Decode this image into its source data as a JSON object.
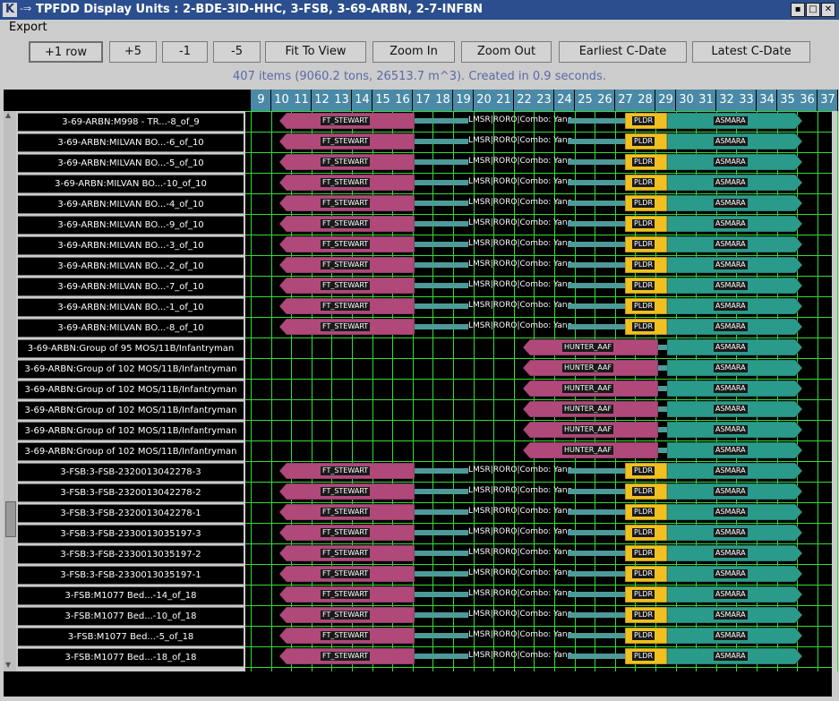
{
  "window": {
    "title": "TPFDD Display Units : 2-BDE-3ID-HHC, 3-FSB, 3-69-ARBN, 2-7-INFBN",
    "app_icon": "K",
    "arrow_icon": "-⇒",
    "buttons": [
      "▪",
      "□",
      "✕"
    ]
  },
  "menu": {
    "export": "Export"
  },
  "toolbar": [
    "+1 row",
    "+5",
    "-1",
    "-5",
    "Fit To View",
    "Zoom In",
    "Zoom Out",
    "Earliest C-Date",
    "Latest C-Date"
  ],
  "status_text": "407 items (9060.2 tons, 26513.7 m^3). Created in 0.9 seconds.",
  "day_header": [
    9,
    10,
    11,
    12,
    13,
    14,
    15,
    16,
    17,
    18,
    19,
    20,
    21,
    22,
    23,
    24,
    25,
    26,
    27,
    28,
    29,
    30,
    31,
    32,
    33,
    34,
    35,
    36,
    37
  ],
  "colors": {
    "origin_bar": "#b0487a",
    "pod_bar": "#f0c020",
    "dest_bar": "#2a9b8a",
    "grid": "#33dd33"
  },
  "rows": [
    {
      "label": "3-69-ARBN:M998 - TR...-8_of_9",
      "type": "A"
    },
    {
      "label": "3-69-ARBN:MILVAN BO...-6_of_10",
      "type": "A"
    },
    {
      "label": "3-69-ARBN:MILVAN BO...-5_of_10",
      "type": "A"
    },
    {
      "label": "3-69-ARBN:MILVAN BO...-10_of_10",
      "type": "A"
    },
    {
      "label": "3-69-ARBN:MILVAN BO...-4_of_10",
      "type": "A"
    },
    {
      "label": "3-69-ARBN:MILVAN BO...-9_of_10",
      "type": "A"
    },
    {
      "label": "3-69-ARBN:MILVAN BO...-3_of_10",
      "type": "A"
    },
    {
      "label": "3-69-ARBN:MILVAN BO...-2_of_10",
      "type": "A"
    },
    {
      "label": "3-69-ARBN:MILVAN BO...-7_of_10",
      "type": "A"
    },
    {
      "label": "3-69-ARBN:MILVAN BO...-1_of_10",
      "type": "A"
    },
    {
      "label": "3-69-ARBN:MILVAN BO...-8_of_10",
      "type": "A"
    },
    {
      "label": "3-69-ARBN:Group of 95 MOS/11B/Infantryman",
      "type": "B"
    },
    {
      "label": "3-69-ARBN:Group of 102 MOS/11B/Infantryman",
      "type": "B"
    },
    {
      "label": "3-69-ARBN:Group of 102 MOS/11B/Infantryman",
      "type": "B"
    },
    {
      "label": "3-69-ARBN:Group of 102 MOS/11B/Infantryman",
      "type": "B"
    },
    {
      "label": "3-69-ARBN:Group of 102 MOS/11B/Infantryman",
      "type": "B"
    },
    {
      "label": "3-69-ARBN:Group of 102 MOS/11B/Infantryman",
      "type": "B"
    },
    {
      "label": "3-FSB:3-FSB-2320013042278-3",
      "type": "A"
    },
    {
      "label": "3-FSB:3-FSB-2320013042278-2",
      "type": "A"
    },
    {
      "label": "3-FSB:3-FSB-2320013042278-1",
      "type": "A"
    },
    {
      "label": "3-FSB:3-FSB-2330013035197-3",
      "type": "A"
    },
    {
      "label": "3-FSB:3-FSB-2330013035197-2",
      "type": "A"
    },
    {
      "label": "3-FSB:3-FSB-2330013035197-1",
      "type": "A"
    },
    {
      "label": "3-FSB:M1077 Bed...-14_of_18",
      "type": "A"
    },
    {
      "label": "3-FSB:M1077 Bed...-10_of_18",
      "type": "A"
    },
    {
      "label": "3-FSB:M1077 Bed...-5_of_18",
      "type": "A"
    },
    {
      "label": "3-FSB:M1077 Bed...-18_of_18",
      "type": "A"
    }
  ],
  "bars": {
    "A": {
      "origin": "FT_STEWART",
      "mid": "LMSR|RORO|Combo: Yano",
      "pod": "PLDR",
      "dest": "ASMARA"
    },
    "B": {
      "origin": "HUNTER_AAF",
      "dest": "ASMARA"
    }
  }
}
